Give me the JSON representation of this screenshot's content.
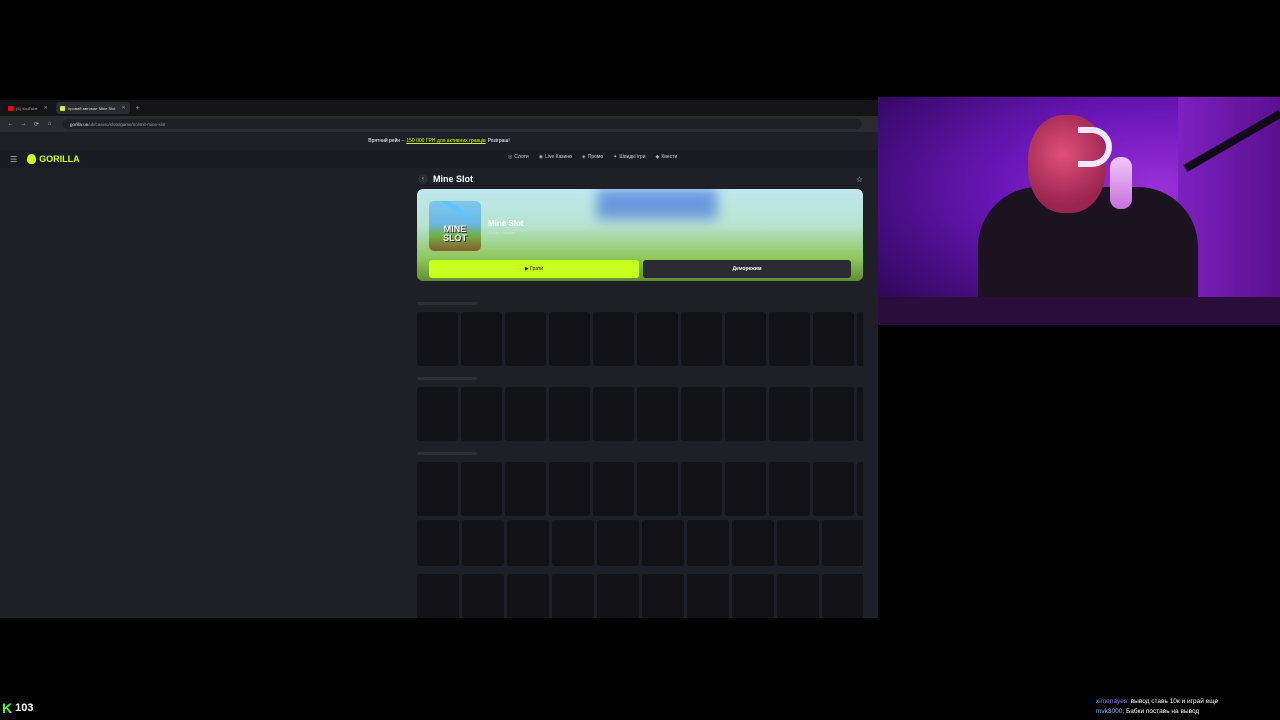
{
  "browser": {
    "tabs": [
      {
        "label": "(5) YouTube",
        "favicon_color": "#ff0000",
        "active": false
      },
      {
        "label": "Ігровий автомат Mine Slot",
        "favicon_color": "#c8ff1e",
        "active": true
      }
    ],
    "url_domain": "gorilla.ua",
    "url_path": "/uk/casino/slots/game/nolimit-mine-slot",
    "nav": {
      "back": "←",
      "forward": "→",
      "reload": "⟳",
      "home": "⌂"
    }
  },
  "site": {
    "promo_prefix": "Врятний рейн –",
    "promo_highlight": "150 000 ГРН для активних гравців",
    "promo_suffix": "Розіграш!",
    "logo": "GORILLA",
    "nav": [
      {
        "icon": "◎",
        "label": "Слоти"
      },
      {
        "icon": "◉",
        "label": "Live Казино"
      },
      {
        "icon": "◈",
        "label": "Промо"
      },
      {
        "icon": "✦",
        "label": "Швидкі ігри"
      },
      {
        "icon": "◆",
        "label": "Квести"
      }
    ],
    "page_title": "Mine Slot",
    "game": {
      "name": "Mine Slot",
      "meta": "Слоти • Nolimit",
      "thumb_text_1": "MINE",
      "thumb_text_2": "SLOT",
      "play_label": "▶ Грати",
      "demo_label": "Деморежим"
    }
  },
  "kick": {
    "logo": "K",
    "viewers": "103"
  },
  "chat": [
    {
      "user": "ximenayes:",
      "text": "вывод ставь 10к и играй еще"
    },
    {
      "user": "mvk3000:",
      "text": "Бабки поставь на вывод"
    }
  ],
  "colors": {
    "accent": "#c8ff1e",
    "kick_green": "#53fc18"
  }
}
